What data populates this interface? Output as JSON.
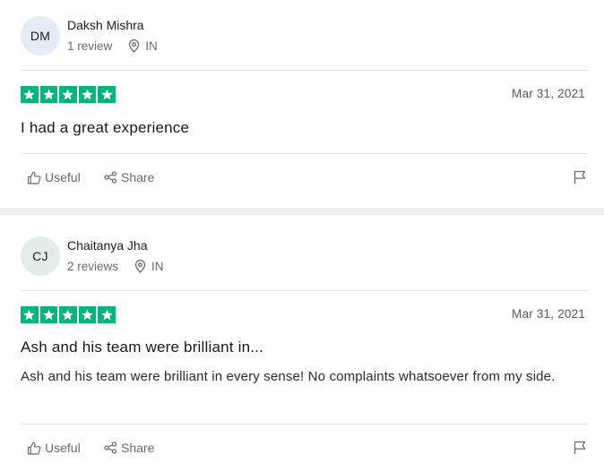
{
  "reviews": [
    {
      "initials": "DM",
      "avatar_bg": "#e4ecf8",
      "name": "Daksh Mishra",
      "review_count": "1 review",
      "country": "IN",
      "rating": 5,
      "date": "Mar 31, 2021",
      "title": "I had a great experience",
      "body": "",
      "useful_label": "Useful",
      "share_label": "Share"
    },
    {
      "initials": "CJ",
      "avatar_bg": "#e2ece9",
      "name": "Chaitanya Jha",
      "review_count": "2 reviews",
      "country": "IN",
      "rating": 5,
      "date": "Mar 31, 2021",
      "title": "Ash and his team were brilliant in...",
      "body": "Ash and his team were brilliant in every sense! No complaints whatsoever from my side.",
      "useful_label": "Useful",
      "share_label": "Share"
    }
  ],
  "colors": {
    "star_green": "#00b67a"
  },
  "icons": {
    "location": "location-pin-icon",
    "useful": "thumbs-up-icon",
    "share": "share-icon",
    "flag": "flag-icon",
    "star": "star-icon"
  }
}
